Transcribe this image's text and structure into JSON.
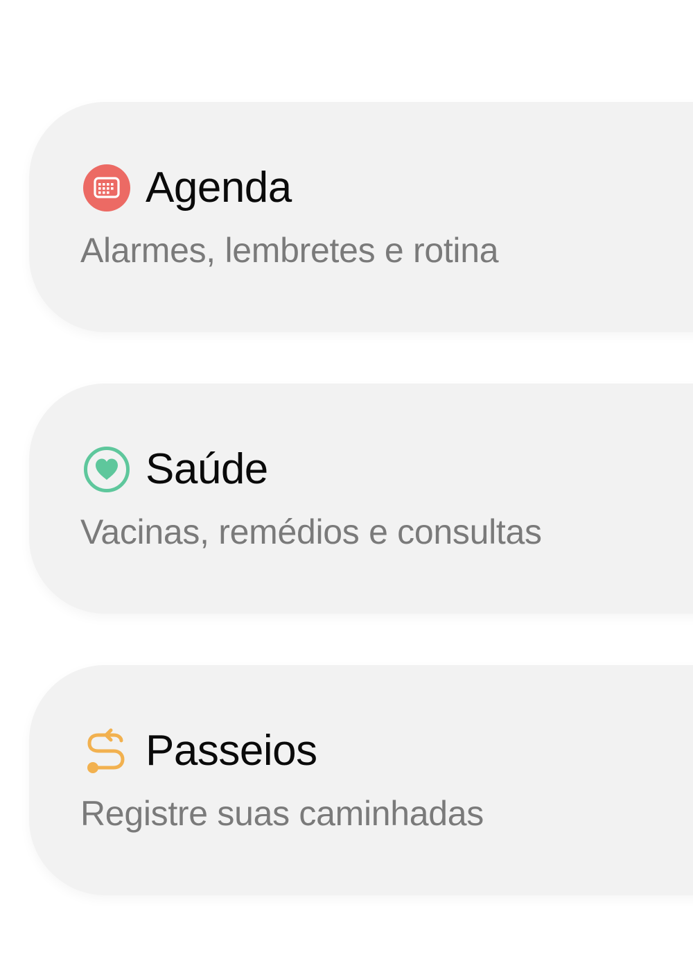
{
  "menu": {
    "items": [
      {
        "title": "Agenda",
        "subtitle": "Alarmes, lembretes e rotina",
        "icon": "calendar-icon",
        "color": "#ec6a64"
      },
      {
        "title": "Saúde",
        "subtitle": "Vacinas, remédios e consultas",
        "icon": "heart-icon",
        "color": "#5ec79c"
      },
      {
        "title": "Passeios",
        "subtitle": "Registre suas caminhadas",
        "icon": "route-icon",
        "color": "#f2b14f"
      }
    ]
  }
}
